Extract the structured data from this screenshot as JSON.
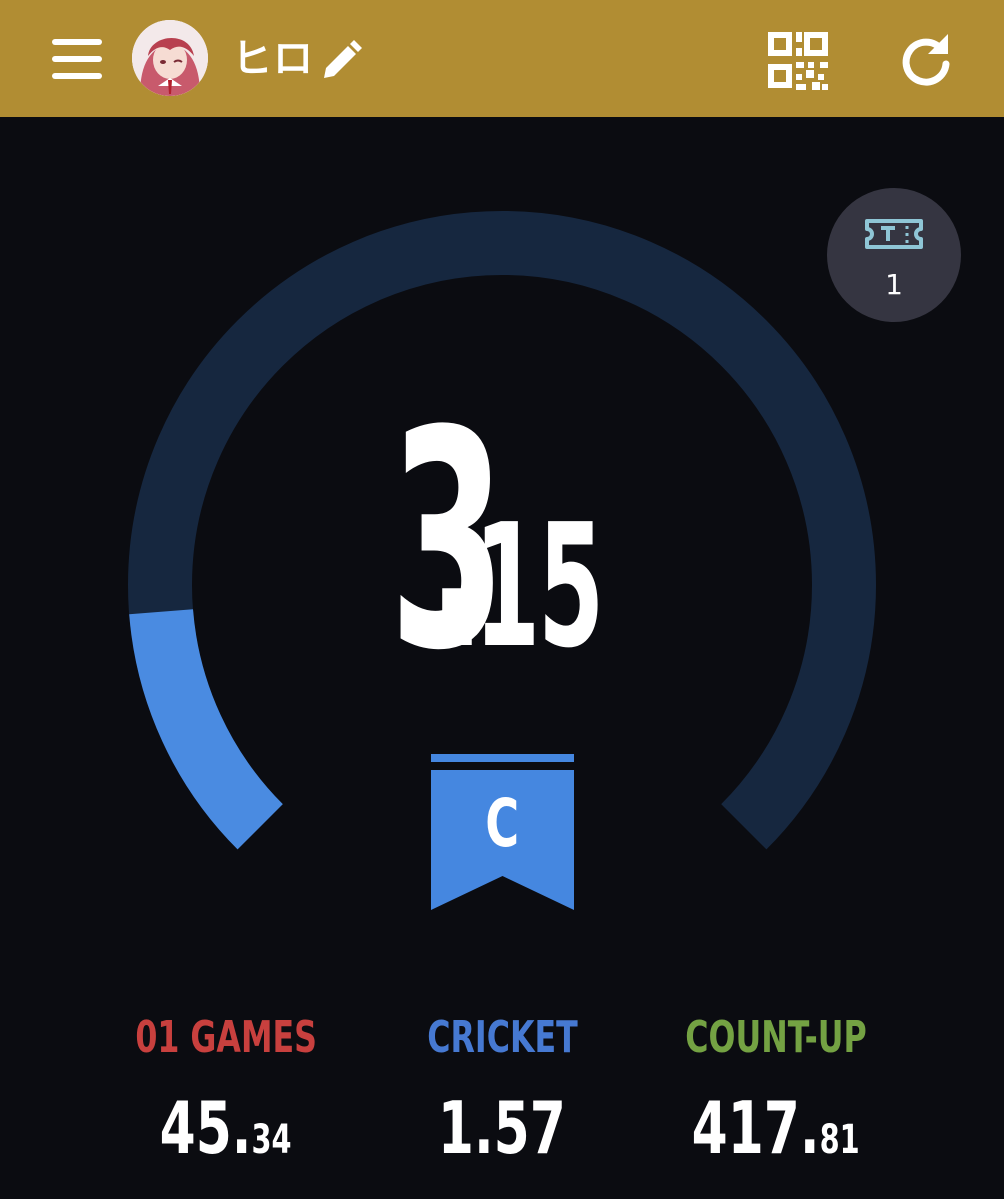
{
  "header": {
    "player_name": "ヒロ",
    "background_color": "#b18d33",
    "icons": [
      "menu-icon",
      "avatar",
      "pencil-icon",
      "qr-code-icon",
      "refresh-icon"
    ]
  },
  "ticket": {
    "count": "1",
    "icon": "ticket-icon"
  },
  "rating": {
    "integer": "3",
    "decimal": "15",
    "progress_fraction": 0.15,
    "track_color": "#16273f",
    "fill_color": "#4a8be1"
  },
  "rank": {
    "letter": "C",
    "color": "#4587e0"
  },
  "stats": {
    "games01": {
      "label": "01 GAMES",
      "integer": "45.",
      "decimal": "34",
      "color": "#c8403e"
    },
    "cricket": {
      "label": "CRICKET",
      "integer": "1.57",
      "decimal": "",
      "color": "#4679d2"
    },
    "countup": {
      "label": "COUNT-UP",
      "integer": "417.",
      "decimal": "81",
      "color": "#74a243"
    }
  }
}
